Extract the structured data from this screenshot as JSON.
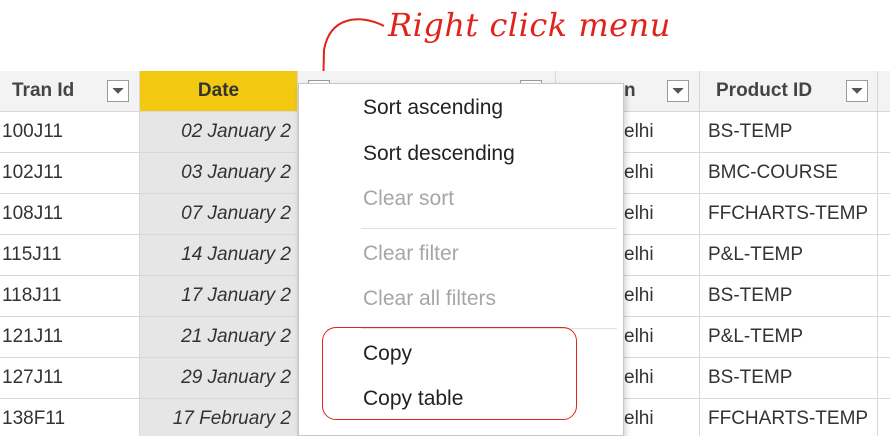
{
  "annotation": {
    "label": "Right click menu",
    "color": "#e0241b"
  },
  "table": {
    "headers": [
      {
        "label": "Tran Id"
      },
      {
        "label": "Date"
      },
      {
        "label": ""
      },
      {
        "label": "n"
      },
      {
        "label": "Product ID"
      }
    ],
    "rows": [
      {
        "tran_id": "100J11",
        "date": "02 January 2",
        "city": "elhi",
        "product": "BS-TEMP"
      },
      {
        "tran_id": "102J11",
        "date": "03 January 2",
        "city": "elhi",
        "product": "BMC-COURSE"
      },
      {
        "tran_id": "108J11",
        "date": "07 January 2",
        "city": "elhi",
        "product": "FFCHARTS-TEMP"
      },
      {
        "tran_id": "115J11",
        "date": "14 January 2",
        "city": "elhi",
        "product": "P&L-TEMP"
      },
      {
        "tran_id": "118J11",
        "date": "17 January 2",
        "city": "elhi",
        "product": "BS-TEMP"
      },
      {
        "tran_id": "121J11",
        "date": "21 January 2",
        "city": "elhi",
        "product": "P&L-TEMP"
      },
      {
        "tran_id": "127J11",
        "date": "29 January 2",
        "city": "elhi",
        "product": "BS-TEMP"
      },
      {
        "tran_id": "138F11",
        "date": "17 February 2",
        "city": "elhi",
        "product": "FFCHARTS-TEMP"
      }
    ]
  },
  "context_menu": {
    "sort_ascending": "Sort ascending",
    "sort_descending": "Sort descending",
    "clear_sort": "Clear sort",
    "clear_filter": "Clear filter",
    "clear_all_filters": "Clear all filters",
    "copy": "Copy",
    "copy_table": "Copy table"
  },
  "colors": {
    "selected_header": "#f2c811",
    "selected_column": "#e6e6e6",
    "highlight": "#e0241b"
  }
}
